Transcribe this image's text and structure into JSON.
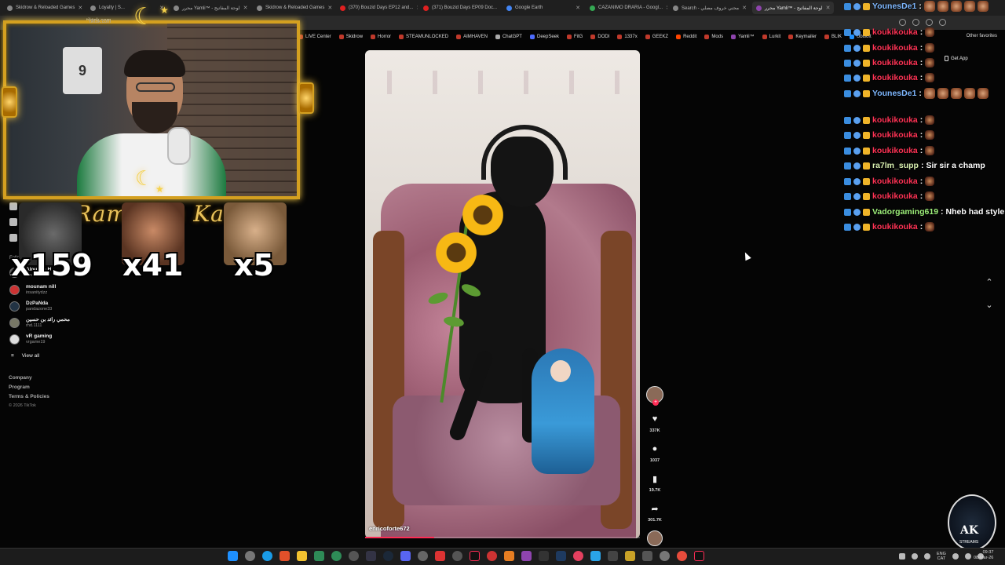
{
  "browser": {
    "tabs": [
      {
        "label": "Skidrow & Reloaded Games"
      },
      {
        "label": "Loyalty | S..."
      },
      {
        "label": "محرر Yamli™ - لوحة المفاتيح"
      },
      {
        "label": "Skidrow & Reloaded Games"
      },
      {
        "label": "(370) Bouzid Days EP12 and..."
      },
      {
        "label": "(371) Bouzid Days EP09 Doc..."
      },
      {
        "label": "Google Earth"
      },
      {
        "label": "CAZANIMO DRARIA - Googl..."
      },
      {
        "label": "Search - محني خروف مصلي"
      },
      {
        "label": "محرر Yamli™ - لوحة المفاتيح"
      }
    ],
    "url": "tiktok.com",
    "bookmarks": [
      "LIVE Center",
      "Skidrow",
      "Horror",
      "STEAMUNLOCKED",
      "AIMHAVEN",
      "ChatGPT",
      "DeepSeek",
      "FitG",
      "DODI",
      "1337x",
      "GEEKZ",
      "Reddit",
      "Mods",
      "Yamli™",
      "Lurkit",
      "Keymailer",
      "BLIK",
      "Ubisoft"
    ],
    "other_favorites": "Other favorites",
    "get_app": "Get App"
  },
  "overlay": {
    "ramadan_text": "Ramadan Kareem",
    "jersey_number": "9",
    "emote_counters": [
      {
        "count": "x159"
      },
      {
        "count": "x41"
      },
      {
        "count": "x5"
      }
    ]
  },
  "tiktok": {
    "following_label": "Following accounts",
    "accounts": [
      {
        "name": "Alouane H",
        "handle": "alouanet"
      },
      {
        "name": "mounam nill",
        "handle": "insanitydzz"
      },
      {
        "name": "DzPaNda",
        "handle": "pandazone33"
      },
      {
        "name": "محمي رائد بن حسين",
        "handle": "rhd.1111"
      },
      {
        "name": "vR gaming",
        "handle": "vrgame19"
      }
    ],
    "view_all": "View all",
    "footer": [
      "Company",
      "Program",
      "Terms & Policies"
    ],
    "copyright": "© 2026 TikTok",
    "video": {
      "username": "enricoforte672",
      "progress": 0.25
    },
    "actions": {
      "likes": "337K",
      "comments": "1037",
      "saves": "19.7K",
      "shares": "301.7K"
    }
  },
  "chat": {
    "messages": [
      {
        "user": "YounesDe1",
        "color": "#7fb8ff",
        "text": "",
        "emotes": 5
      },
      {
        "user": "koukikouka",
        "color": "#ff3355",
        "text": "",
        "emotes": 1
      },
      {
        "user": "koukikouka",
        "color": "#ff3355",
        "text": "",
        "emotes": 1
      },
      {
        "user": "koukikouka",
        "color": "#ff3355",
        "text": "",
        "emotes": 1
      },
      {
        "user": "koukikouka",
        "color": "#ff3355",
        "text": "",
        "emotes": 1
      },
      {
        "user": "YounesDe1",
        "color": "#7fb8ff",
        "text": "",
        "emotes": 5
      },
      {
        "user": "koukikouka",
        "color": "#ff3355",
        "text": "",
        "emotes": 1
      },
      {
        "user": "koukikouka",
        "color": "#ff3355",
        "text": "",
        "emotes": 1
      },
      {
        "user": "koukikouka",
        "color": "#ff3355",
        "text": "",
        "emotes": 1
      },
      {
        "user": "ra7lm_supp",
        "color": "#d9f0b0",
        "text": "Sir sir a champ",
        "emotes": 0
      },
      {
        "user": "koukikouka",
        "color": "#ff3355",
        "text": "",
        "emotes": 1
      },
      {
        "user": "koukikouka",
        "color": "#ff3355",
        "text": "",
        "emotes": 1
      },
      {
        "user": "Vadorgaming619",
        "color": "#9ef07a",
        "text": "Nheb had style",
        "emotes": 0
      },
      {
        "user": "koukikouka",
        "color": "#ff3355",
        "text": "",
        "emotes": 1
      }
    ]
  },
  "logo": {
    "text": "AK",
    "sub": "STREAMS"
  },
  "taskbar": {
    "lang_top": "ENG",
    "lang_bottom": "CAT",
    "time": "09:37",
    "date": "08-Mar-26"
  },
  "colors": {
    "accent_gold": "#d4a020",
    "tiktok_red": "#fe2c55"
  }
}
